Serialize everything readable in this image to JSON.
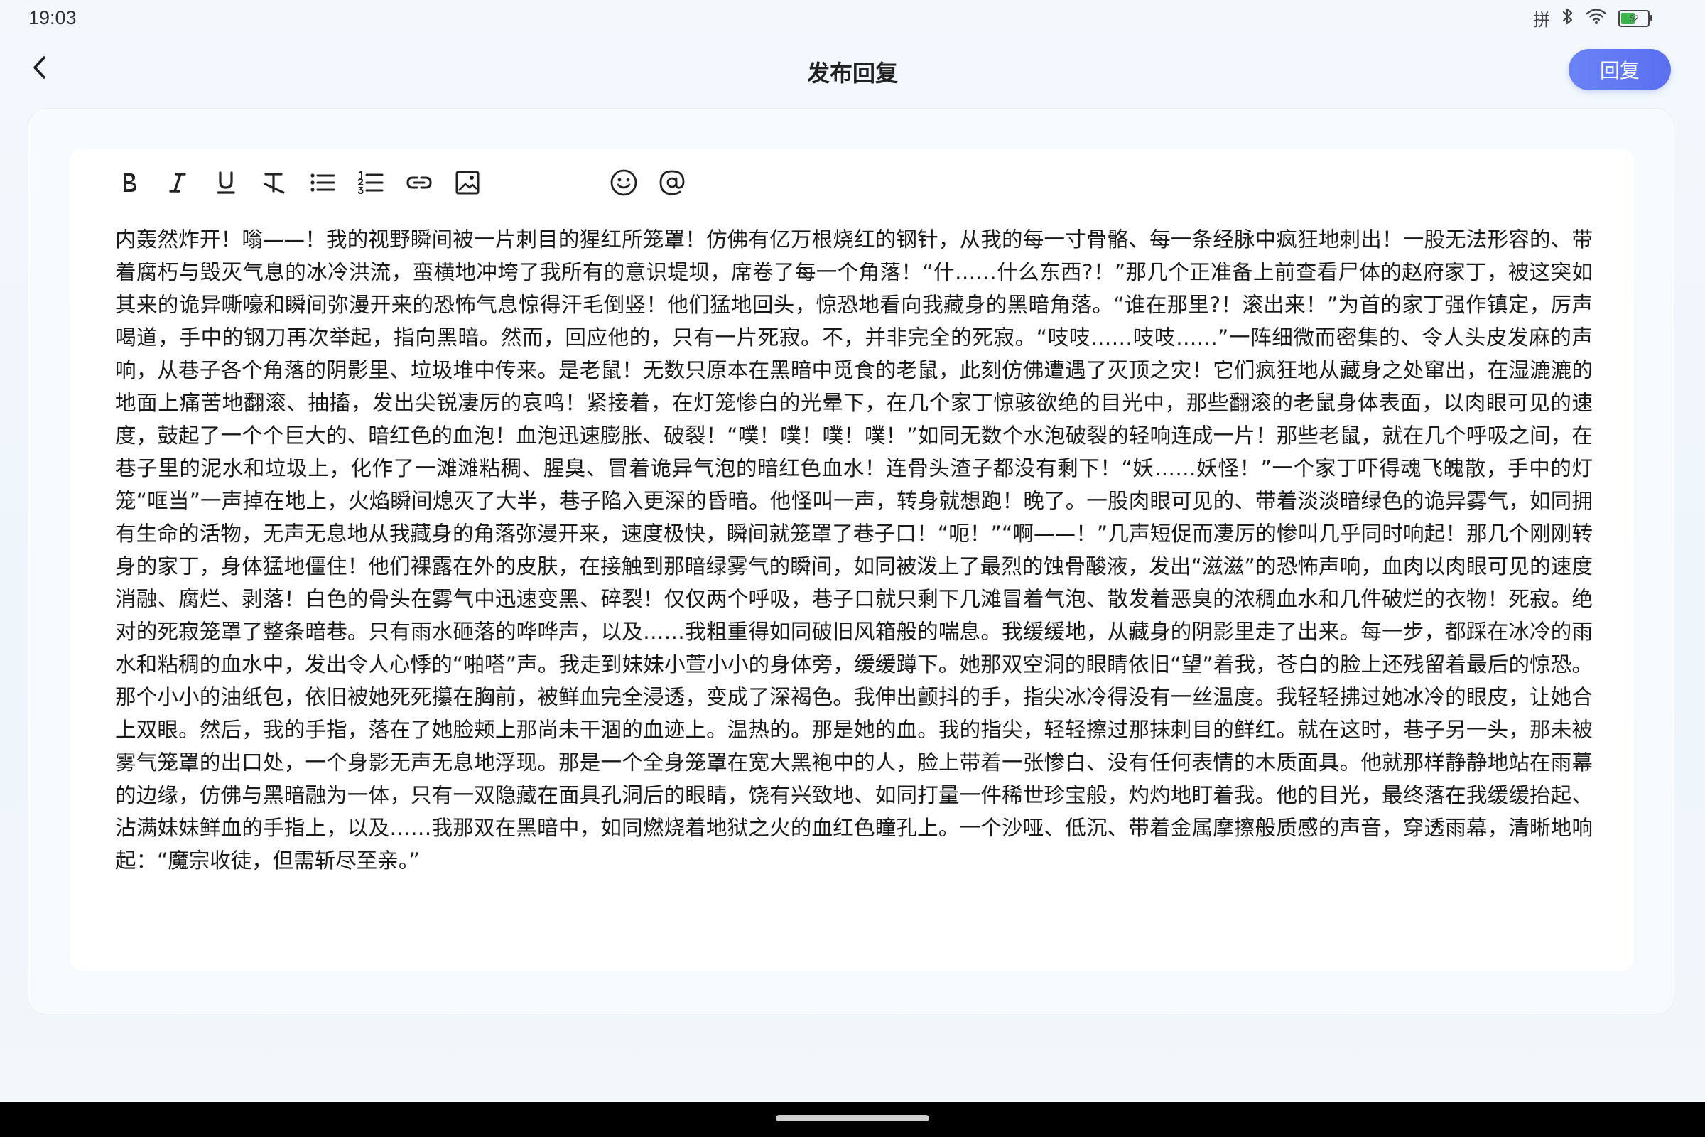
{
  "status_bar": {
    "time": "19:03",
    "ime": "拼",
    "battery_level": "52",
    "icons": [
      "bluetooth-icon",
      "wifi-icon",
      "battery-icon"
    ]
  },
  "header": {
    "title": "发布回复",
    "reply_label": "回复",
    "accent_color": "#5b6ff0"
  },
  "toolbar": {
    "items": [
      "bold-icon",
      "italic-icon",
      "underline-icon",
      "clear-format-icon",
      "bullet-list-icon",
      "numbered-list-icon",
      "link-icon",
      "image-icon",
      "emoji-icon",
      "mention-icon"
    ]
  },
  "editor": {
    "content": "内轰然炸开！嗡——！我的视野瞬间被一片刺目的猩红所笼罩！仿佛有亿万根烧红的钢针，从我的每一寸骨骼、每一条经脉中疯狂地刺出！一股无法形容的、带着腐朽与毁灭气息的冰冷洪流，蛮横地冲垮了我所有的意识堤坝，席卷了每一个角落！“什……什么东西?！”那几个正准备上前查看尸体的赵府家丁，被这突如其来的诡异嘶嚎和瞬间弥漫开来的恐怖气息惊得汗毛倒竖！他们猛地回头，惊恐地看向我藏身的黑暗角落。“谁在那里?！滚出来！”为首的家丁强作镇定，厉声喝道，手中的钢刀再次举起，指向黑暗。然而，回应他的，只有一片死寂。不，并非完全的死寂。“吱吱……吱吱……”一阵细微而密集的、令人头皮发麻的声响，从巷子各个角落的阴影里、垃圾堆中传来。是老鼠！无数只原本在黑暗中觅食的老鼠，此刻仿佛遭遇了灭顶之灾！它们疯狂地从藏身之处窜出，在湿漉漉的地面上痛苦地翻滚、抽搐，发出尖锐凄厉的哀鸣！紧接着，在灯笼惨白的光晕下，在几个家丁惊骇欲绝的目光中，那些翻滚的老鼠身体表面，以肉眼可见的速度，鼓起了一个个巨大的、暗红色的血泡！血泡迅速膨胀、破裂！“噗！噗！噗！噗！”如同无数个水泡破裂的轻响连成一片！那些老鼠，就在几个呼吸之间，在巷子里的泥水和垃圾上，化作了一滩滩粘稠、腥臭、冒着诡异气泡的暗红色血水！连骨头渣子都没有剩下！“妖……妖怪！”一个家丁吓得魂飞魄散，手中的灯笼“哐当”一声掉在地上，火焰瞬间熄灭了大半，巷子陷入更深的昏暗。他怪叫一声，转身就想跑！晚了。一股肉眼可见的、带着淡淡暗绿色的诡异雾气，如同拥有生命的活物，无声无息地从我藏身的角落弥漫开来，速度极快，瞬间就笼罩了巷子口！“呃！”“啊——！”几声短促而凄厉的惨叫几乎同时响起！那几个刚刚转身的家丁，身体猛地僵住！他们裸露在外的皮肤，在接触到那暗绿雾气的瞬间，如同被泼上了最烈的蚀骨酸液，发出“滋滋”的恐怖声响，血肉以肉眼可见的速度消融、腐烂、剥落！白色的骨头在雾气中迅速变黑、碎裂！仅仅两个呼吸，巷子口就只剩下几滩冒着气泡、散发着恶臭的浓稠血水和几件破烂的衣物！死寂。绝对的死寂笼罩了整条暗巷。只有雨水砸落的哗哗声，以及……我粗重得如同破旧风箱般的喘息。我缓缓地，从藏身的阴影里走了出来。每一步，都踩在冰冷的雨水和粘稠的血水中，发出令人心悸的“啪嗒”声。我走到妹妹小萱小小的身体旁，缓缓蹲下。她那双空洞的眼睛依旧“望”着我，苍白的脸上还残留着最后的惊恐。那个小小的油纸包，依旧被她死死攥在胸前，被鲜血完全浸透，变成了深褐色。我伸出颤抖的手，指尖冰冷得没有一丝温度。我轻轻拂过她冰冷的眼皮，让她合上双眼。然后，我的手指，落在了她脸颊上那尚未干涸的血迹上。温热的。那是她的血。我的指尖，轻轻擦过那抹刺目的鲜红。就在这时，巷子另一头，那未被雾气笼罩的出口处，一个身影无声无息地浮现。那是一个全身笼罩在宽大黑袍中的人，脸上带着一张惨白、没有任何表情的木质面具。他就那样静静地站在雨幕的边缘，仿佛与黑暗融为一体，只有一双隐藏在面具孔洞后的眼睛，饶有兴致地、如同打量一件稀世珍宝般，灼灼地盯着我。他的目光，最终落在我缓缓抬起、沾满妹妹鲜血的手指上，以及……我那双在黑暗中，如同燃烧着地狱之火的血红色瞳孔上。一个沙哑、低沉、带着金属摩擦般质感的声音，穿透雨幕，清晰地响起：“魔宗收徒，但需斩尽至亲。”"
  }
}
